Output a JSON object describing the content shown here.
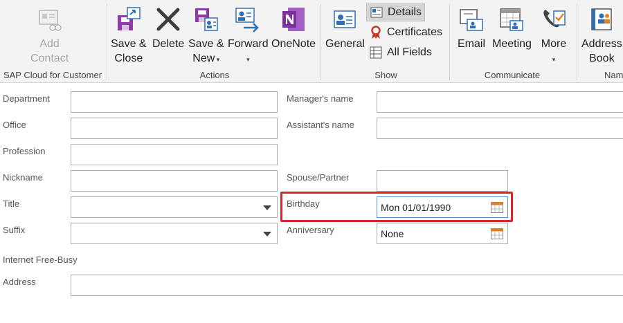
{
  "ribbon": {
    "groups": {
      "sap": "SAP Cloud for Customer",
      "actions": "Actions",
      "show": "Show",
      "communicate": "Communicate",
      "names": "Nam"
    },
    "add_contact": {
      "line1": "Add",
      "line2": "Contact"
    },
    "save_close": {
      "line1": "Save &",
      "line2": "Close"
    },
    "delete": {
      "line1": "Delete"
    },
    "save_new": {
      "line1": "Save &",
      "line2": "New"
    },
    "forward": {
      "line1": "Forward"
    },
    "onenote": {
      "line1": "OneNote"
    },
    "general": {
      "line1": "General"
    },
    "details": "Details",
    "certificates": "Certificates",
    "all_fields": "All Fields",
    "email": {
      "line1": "Email"
    },
    "meeting": {
      "line1": "Meeting"
    },
    "more": {
      "line1": "More"
    },
    "address_book": {
      "line1": "Address",
      "line2": "Book"
    },
    "colors": {
      "onenote": "#7b2e9e",
      "save": "#8e3aa8",
      "accent_blue": "#2e6fb8",
      "certificate": "#c0392b",
      "highlight": "#d9262c"
    }
  },
  "form": {
    "department": {
      "label": "Department",
      "value": ""
    },
    "office": {
      "label": "Office",
      "value": ""
    },
    "profession": {
      "label": "Profession",
      "value": ""
    },
    "nickname": {
      "label": "Nickname",
      "value": ""
    },
    "title": {
      "label": "Title",
      "value": ""
    },
    "suffix": {
      "label": "Suffix",
      "value": ""
    },
    "manager": {
      "label": "Manager's name",
      "value": ""
    },
    "assistant": {
      "label": "Assistant's name",
      "value": ""
    },
    "spouse": {
      "label": "Spouse/Partner",
      "value": ""
    },
    "birthday": {
      "label": "Birthday",
      "value": "Mon 01/01/1990"
    },
    "anniversary": {
      "label": "Anniversary",
      "value": "None"
    },
    "free_busy": {
      "label": "Internet Free-Busy"
    },
    "address": {
      "label": "Address",
      "value": ""
    }
  }
}
